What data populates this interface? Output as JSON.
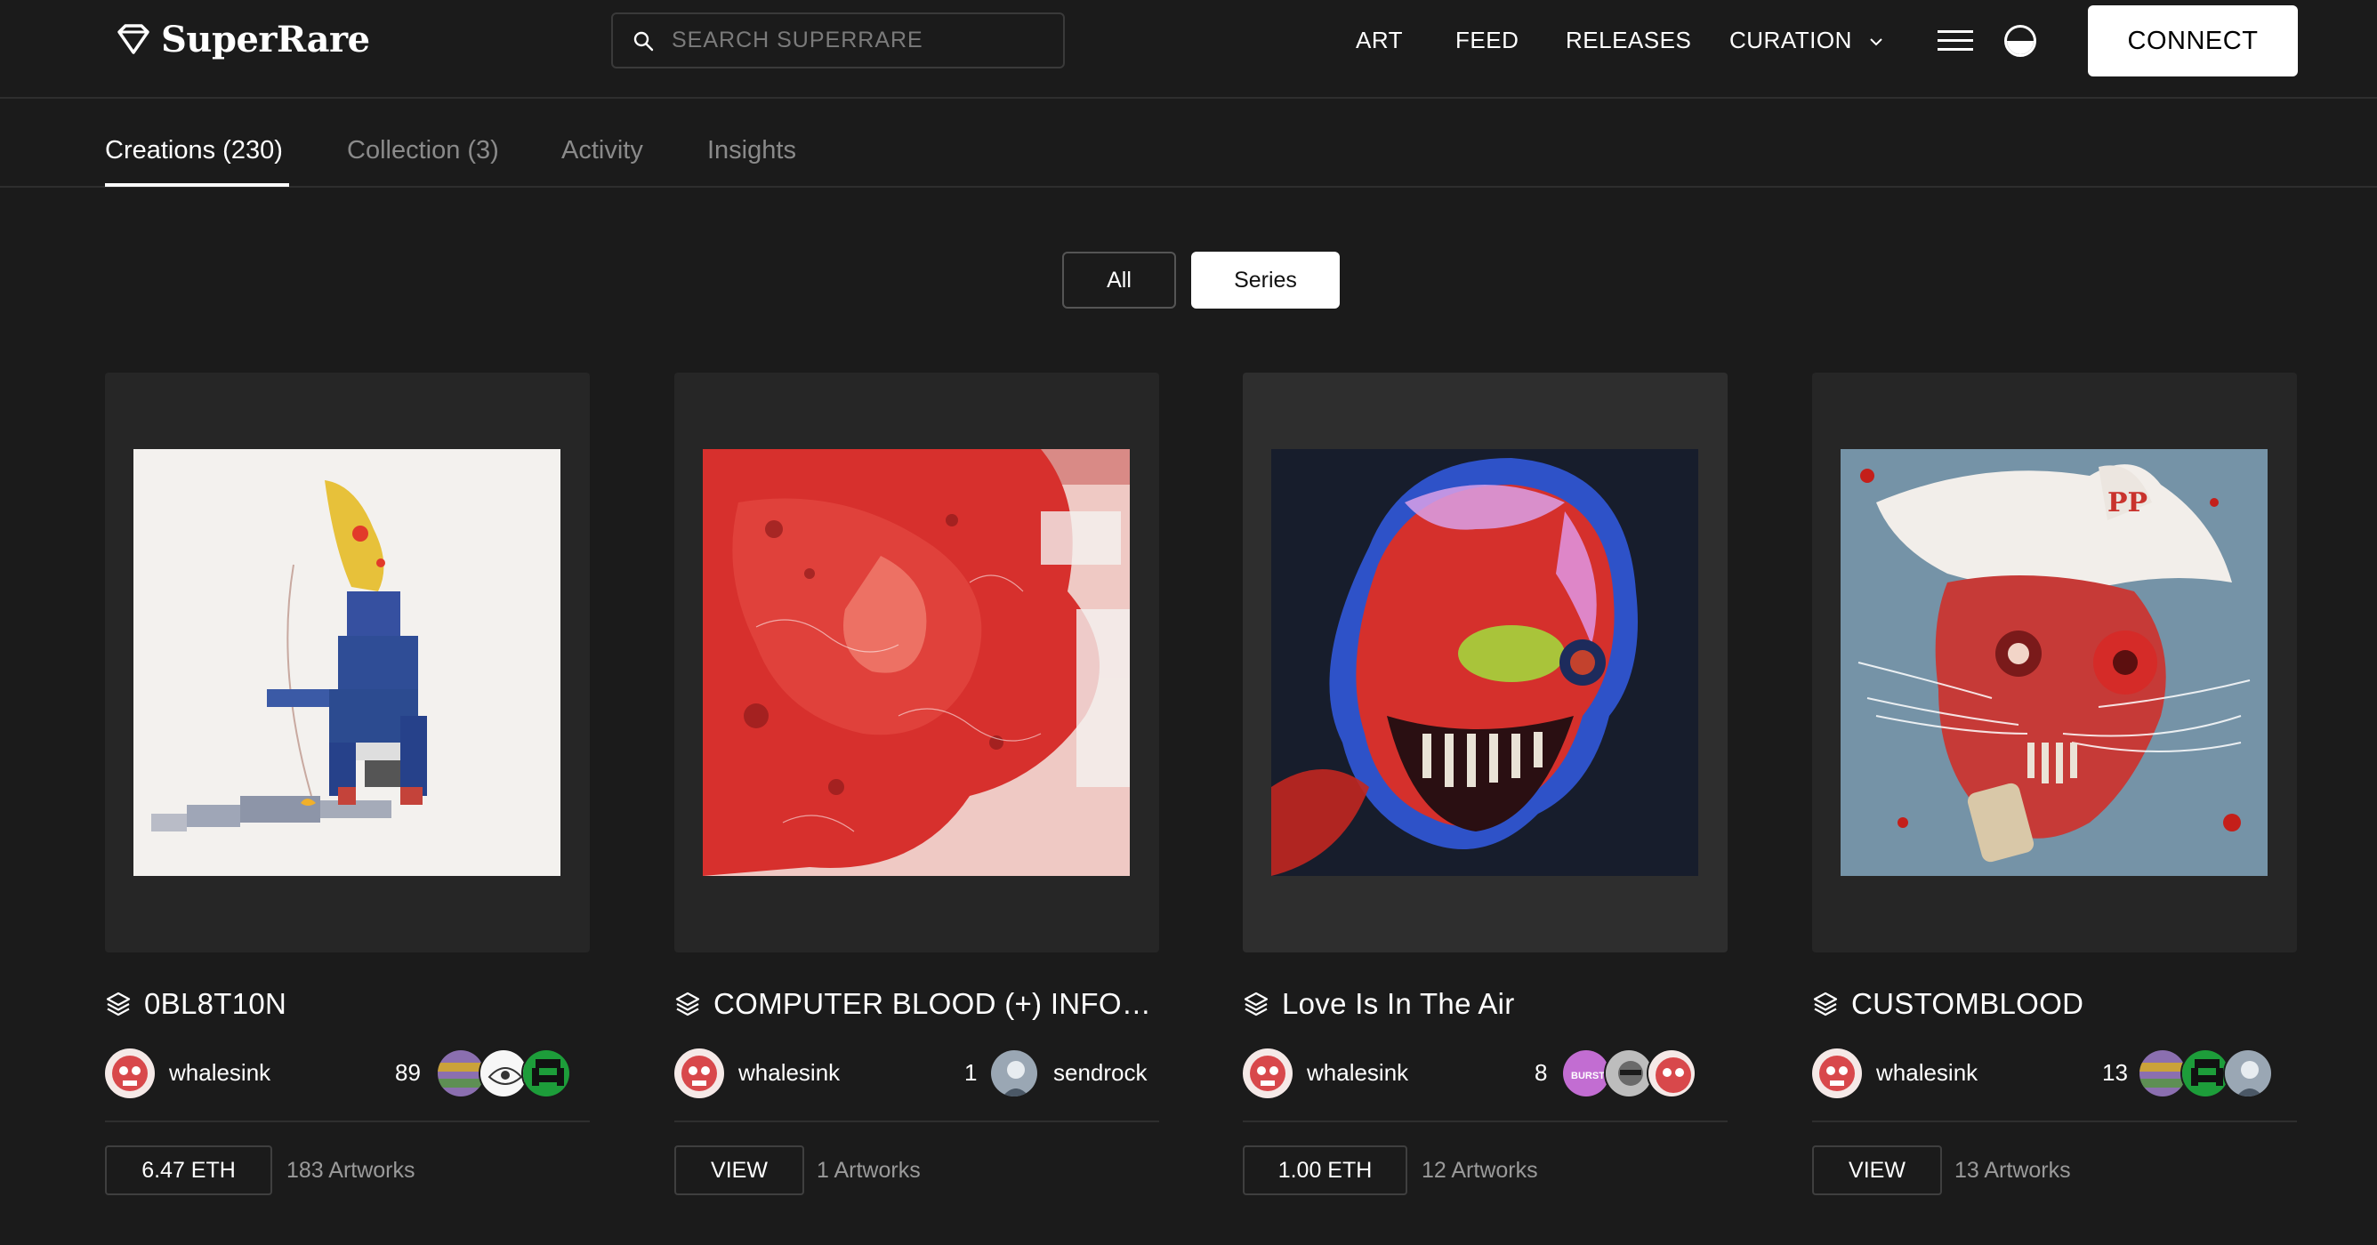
{
  "header": {
    "logo_text": "SuperRare",
    "search_placeholder": "SEARCH SUPERRARE",
    "nav": [
      "ART",
      "FEED",
      "RELEASES",
      "CURATION"
    ],
    "connect_label": "CONNECT"
  },
  "tabs": [
    {
      "label": "Creations (230)",
      "active": true
    },
    {
      "label": "Collection (3)",
      "active": false
    },
    {
      "label": "Activity",
      "active": false
    },
    {
      "label": "Insights",
      "active": false
    }
  ],
  "view_toggle": {
    "all_label": "All",
    "series_label": "Series",
    "selected": "Series"
  },
  "cards": [
    {
      "title": "0BL8T10N",
      "creator": "whalesink",
      "owner_count": "89",
      "owner_name": "",
      "price_label": "6.47 ETH",
      "artworks": "183 Artworks"
    },
    {
      "title": "COMPUTER BLOOD (+) INFOG...",
      "creator": "whalesink",
      "owner_count": "1",
      "owner_name": "sendrock",
      "price_label": "VIEW",
      "artworks": "1 Artworks"
    },
    {
      "title": "Love Is In The Air",
      "creator": "whalesink",
      "owner_count": "8",
      "owner_name": "",
      "price_label": "1.00 ETH",
      "artworks": "12 Artworks"
    },
    {
      "title": "CUSTOMBLOOD",
      "creator": "whalesink",
      "owner_count": "13",
      "owner_name": "",
      "price_label": "VIEW",
      "artworks": "13 Artworks"
    }
  ],
  "owner_badge_text": "BURST",
  "colors": {
    "background": "#1b1b1b",
    "card_bg": "#262626",
    "accent_white": "#ffffff",
    "muted": "#8a8a8a"
  }
}
